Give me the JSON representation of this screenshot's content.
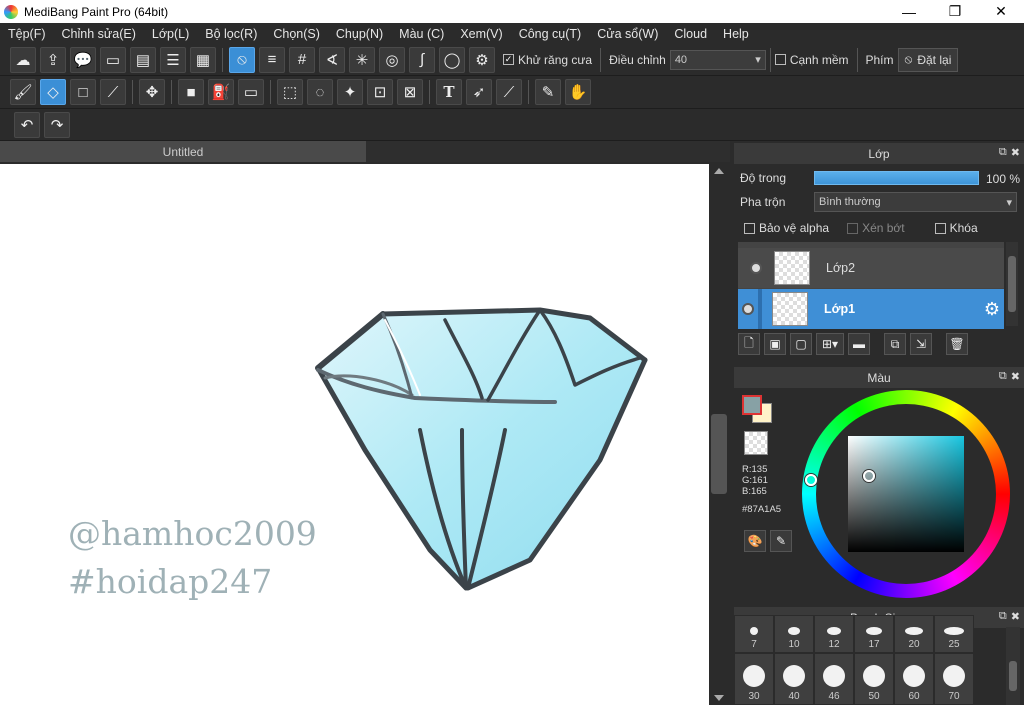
{
  "window": {
    "title": "MediBang Paint Pro (64bit)",
    "minimize": "—",
    "maximize": "❐",
    "close": "✕"
  },
  "menu": [
    "Tệp(F)",
    "Chỉnh sửa(E)",
    "Lớp(L)",
    "Bộ lọc(R)",
    "Chọn(S)",
    "Chụp(N)",
    "Màu (C)",
    "Xem(V)",
    "Công cụ(T)",
    "Cửa sổ(W)",
    "Cloud",
    "Help"
  ],
  "toolbar1": {
    "antialias_label": "Khử răng cưa",
    "antialias_checked": true,
    "adjust_label": "Điều chỉnh",
    "adjust_value": "40",
    "soft_edge_label": "Cạnh mềm",
    "soft_edge_checked": false,
    "key_label": "Phím",
    "reset_label": "Đặt lại"
  },
  "document": {
    "tab": "Untitled",
    "watermark_line1": "@hamhoc2009",
    "watermark_line2": "#hoidap247"
  },
  "layer_panel": {
    "title": "Lớp",
    "opacity_label": "Độ trong",
    "opacity_value": "100 %",
    "opacity_fraction": 1.0,
    "blend_label": "Pha trộn",
    "blend_value": "Bình thường",
    "protect_alpha": "Bảo vệ alpha",
    "clipping": "Xén bớt",
    "lock": "Khóa",
    "layers": [
      {
        "name": "Lớp2",
        "selected": false
      },
      {
        "name": "Lớp1",
        "selected": true
      }
    ]
  },
  "color_panel": {
    "title": "Màu",
    "r": "R:135",
    "g": "G:161",
    "b": "B:165",
    "hex": "#87A1A5",
    "fg_color": "#87A1A5",
    "bg_color": "#FFF3C8"
  },
  "brush_panel": {
    "title": "Brush Size",
    "row1": [
      "7",
      "10",
      "12",
      "17",
      "20",
      "25"
    ],
    "row2": [
      "30",
      "40",
      "46",
      "50",
      "60",
      "70"
    ]
  }
}
